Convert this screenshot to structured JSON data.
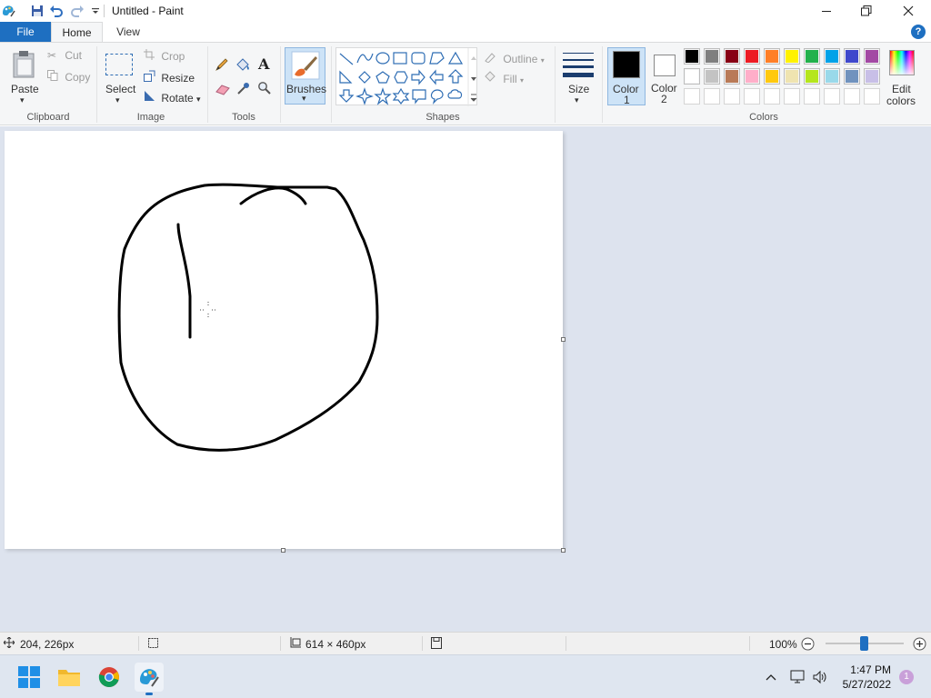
{
  "window": {
    "title": "Untitled - Paint"
  },
  "tabs": {
    "file": "File",
    "home": "Home",
    "view": "View",
    "help": "?"
  },
  "ribbon": {
    "clipboard": {
      "paste": "Paste",
      "cut": "Cut",
      "copy": "Copy",
      "label": "Clipboard"
    },
    "image": {
      "select": "Select",
      "crop": "Crop",
      "resize": "Resize",
      "rotate": "Rotate",
      "label": "Image"
    },
    "tools": {
      "label": "Tools"
    },
    "brushes": {
      "label": "Brushes"
    },
    "shapes": {
      "outline": "Outline",
      "fill": "Fill",
      "label": "Shapes"
    },
    "size": {
      "label": "Size"
    },
    "color1": {
      "line1": "Color",
      "line2": "1",
      "value": "#000000"
    },
    "color2": {
      "line1": "Color",
      "line2": "2",
      "value": "#ffffff"
    },
    "colors": {
      "label": "Colors",
      "edit_line1": "Edit",
      "edit_line2": "colors",
      "palette_row1": [
        "#000000",
        "#7f7f7f",
        "#880015",
        "#ed1c24",
        "#ff7f27",
        "#fff200",
        "#22b14c",
        "#00a2e8",
        "#3f48cc",
        "#a349a4"
      ],
      "palette_row2": [
        "#ffffff",
        "#c3c3c3",
        "#b97a57",
        "#ffaec9",
        "#ffc90e",
        "#efe4b0",
        "#b5e61d",
        "#99d9ea",
        "#7092be",
        "#c8bfe7"
      ],
      "palette_row3": [
        "",
        "",
        "",
        "",
        "",
        "",
        "",
        "",
        "",
        ""
      ]
    }
  },
  "status": {
    "cursor_pos": "204, 226px",
    "canvas_size": "614 × 460px",
    "zoom": "100%"
  },
  "taskbar": {
    "time": "1:47 PM",
    "date": "5/27/2022",
    "notification_count": "1"
  }
}
